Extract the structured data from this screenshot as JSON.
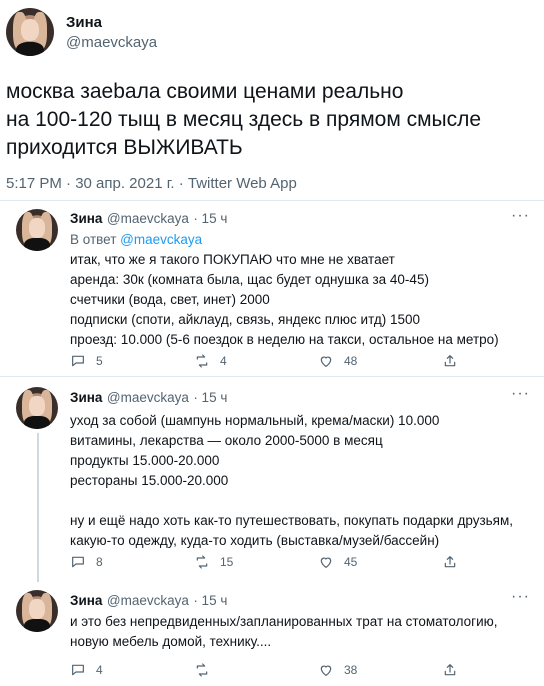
{
  "main": {
    "name": "Зина",
    "handle": "@maevckaya",
    "text_lines": [
      "москва заеbала своими ценами реально",
      "на 100-120 тыщ в месяц здесь в прямом смысле",
      "приходится ВЫЖИВАТЬ"
    ],
    "meta": "5:17 PM · 30 апр. 2021 г. · Twitter Web App"
  },
  "replies": [
    {
      "name": "Зина",
      "handle": "@maevckaya",
      "time": "· 15 ч",
      "reply_to_prefix": "В ответ ",
      "reply_to_handle": "@maevckaya",
      "lines": [
        "итак, что же я такого ПОКУПАЮ что мне не хватает",
        "аренда: 30к (комната была, щас будет однушка за 40-45)",
        "счетчики (вода, свет, инет) 2000",
        "подписки (споти, айклауд, связь, яндекс плюс итд) 1500",
        "проезд: 10.000 (5-6 поездок в неделю на такси, остальное на метро)"
      ],
      "comments": "5",
      "retweets": "4",
      "likes": "48"
    },
    {
      "name": "Зина",
      "handle": "@maevckaya",
      "time": "· 15 ч",
      "lines": [
        "уход за собой (шампунь нормальный, крема/маски) 10.000",
        "витамины, лекарства — около 2000-5000 в месяц",
        "продукты 15.000-20.000",
        "рестораны 15.000-20.000",
        "",
        "ну и ещё надо хоть как-то путешествовать, покупать подарки друзьям,",
        "какую-то одежду, куда-то ходить (выставка/музей/бассейн)"
      ],
      "comments": "8",
      "retweets": "15",
      "likes": "45"
    },
    {
      "name": "Зина",
      "handle": "@maevckaya",
      "time": "· 15 ч",
      "lines": [
        "и это без непредвиденных/запланированных трат на стоматологию,",
        "новую мебель домой, технику...."
      ],
      "comments": "4",
      "retweets": "",
      "likes": "38"
    }
  ],
  "more_label": "···",
  "colors": {
    "accent": "#1d9bf0",
    "muted": "#536471",
    "text": "#0f1419"
  },
  "icons": [
    "comment-icon",
    "retweet-icon",
    "like-icon",
    "share-icon",
    "more-icon"
  ]
}
